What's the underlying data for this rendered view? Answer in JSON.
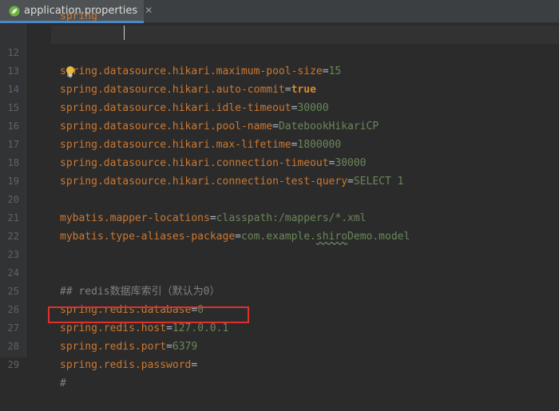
{
  "tab": {
    "icon": "spring-leaf-icon",
    "label": "application.properties",
    "close": "✕"
  },
  "editor": {
    "lines": [
      {
        "no": "12",
        "key": "spring.datasource.hikari.maximum-pool-size",
        "eq": "=",
        "val": "15"
      },
      {
        "no": "13",
        "key": "spring.datasource.hikari.auto-commit",
        "eq": "=",
        "val": "true",
        "bold": true
      },
      {
        "no": "14",
        "key": "spring.datasource.hikari.idle-timeout",
        "eq": "=",
        "val": "30000"
      },
      {
        "no": "15",
        "key": "spring.datasource.hikari.pool-name",
        "eq": "=",
        "val": "DatebookHikariCP"
      },
      {
        "no": "16",
        "key": "spring.datasource.hikari.max-lifetime",
        "eq": "=",
        "val": "1800000"
      },
      {
        "no": "17",
        "key": "spring.datasource.hikari.connection-timeout",
        "eq": "=",
        "val": "30000"
      },
      {
        "no": "18",
        "key": "spring.datasource.hikari.connection-test-query",
        "eq": "=",
        "val": "SELECT 1"
      },
      {
        "no": "19"
      },
      {
        "no": "20",
        "key": "mybatis.mapper-locations",
        "eq": "=",
        "val": "classpath:/mappers/*.xml"
      },
      {
        "no": "21",
        "key": "mybatis.type-aliases-package",
        "eq": "=",
        "val_a": "com.example.",
        "val_b": "shiro",
        "val_c": "Demo.model"
      },
      {
        "no": "22"
      },
      {
        "no": "23"
      },
      {
        "no": "24",
        "comment": "## redis数据库索引（默认为0）"
      },
      {
        "no": "25",
        "key": "spring.redis.database",
        "eq": "=",
        "val": "0"
      },
      {
        "no": "26",
        "key": "spring.redis.host",
        "eq": "=",
        "val": "127.0.0.1"
      },
      {
        "no": "27",
        "key": "spring.redis.port",
        "eq": "=",
        "val": "6379"
      },
      {
        "no": "28",
        "key": "spring.redis.password",
        "eq": "=",
        "val": ""
      },
      {
        "no": "29",
        "comment": "#"
      }
    ]
  },
  "colors": {
    "key": "#cc7832",
    "value": "#6a8759",
    "comment": "#808080",
    "highlight_box": "#e0302c"
  }
}
